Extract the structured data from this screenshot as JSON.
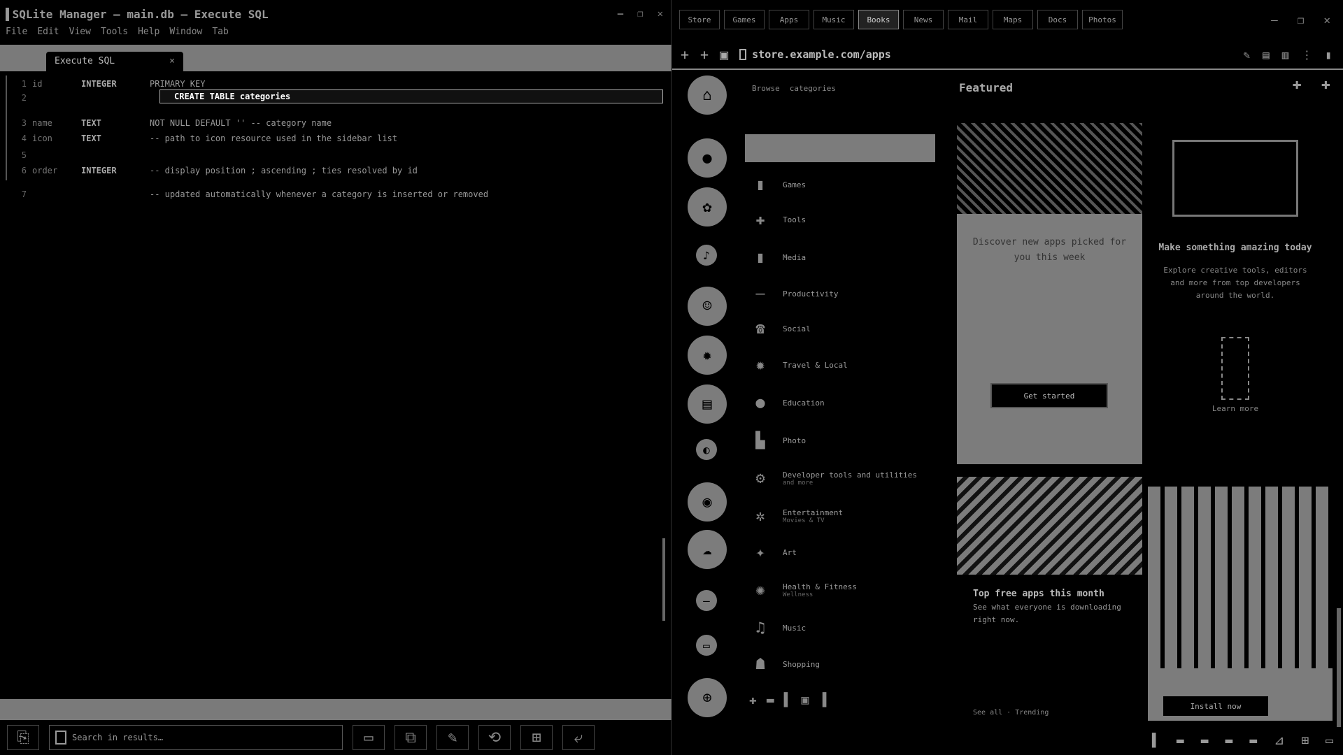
{
  "editor": {
    "title": "▌SQLite Manager — main.db — Execute SQL",
    "title_ctrls": [
      "—",
      "❐",
      "✕"
    ],
    "menu": [
      "File",
      "Edit",
      "View",
      "Tools",
      "Help",
      "Window",
      "Tab"
    ],
    "tab_label": "Execute SQL",
    "tab_close": "×",
    "lines": [
      {
        "ln": "1",
        "fld": "id",
        "nm": "INTEGER",
        "txt": "PRIMARY KEY"
      },
      {
        "ln": "2",
        "fld": "",
        "nm": "",
        "txt": ""
      },
      {
        "ln": "3",
        "fld": "name",
        "nm": "TEXT",
        "txt": "NOT NULL DEFAULT '' -- category name"
      },
      {
        "ln": "4",
        "fld": "icon",
        "nm": "TEXT",
        "txt": "-- path to icon resource used in the sidebar list"
      },
      {
        "ln": "5",
        "fld": "",
        "nm": "",
        "txt": ""
      },
      {
        "ln": "6",
        "fld": "order",
        "nm": "INTEGER",
        "txt": "-- display position ; ascending ; ties resolved by id"
      },
      {
        "ln": "7",
        "fld": "",
        "nm": "",
        "txt": "-- updated automatically whenever a category is inserted or removed"
      }
    ],
    "current_cell": "CREATE TABLE categories",
    "search_placeholder": "Search in results…",
    "bottom_icons": [
      "⎘",
      "▭",
      "⧉",
      "✎",
      "⟲",
      "⊞",
      "⤶"
    ]
  },
  "browser": {
    "tabs": [
      "Store",
      "Games",
      "Apps",
      "Music",
      "Books",
      "News",
      "Mail",
      "Maps",
      "Docs",
      "Photos"
    ],
    "window_ctrls": [
      "—",
      "❐",
      "✕"
    ],
    "nav_buttons": [
      "+",
      "+",
      "▣",
      "▯"
    ],
    "url": "store.example.com/apps",
    "addr_right": [
      "✎",
      "▤",
      "▥",
      "⋮",
      "▮"
    ],
    "rail_icons": [
      "⌂",
      "●",
      "✿",
      "♪",
      "☺",
      "✹",
      "▤",
      "◐",
      "◉",
      "☁",
      "—",
      "▭",
      "⊕"
    ],
    "cats_head": [
      "Browse",
      "categories"
    ],
    "categories": [
      {
        "icon": "▮",
        "label": "Games"
      },
      {
        "icon": "✚",
        "label": "Tools"
      },
      {
        "icon": "▮",
        "label": "Media"
      },
      {
        "icon": "—",
        "label": "Productivity"
      },
      {
        "icon": "☎",
        "label": "Social"
      },
      {
        "icon": "✹",
        "label": "Travel & Local"
      },
      {
        "icon": "●",
        "label": "Education"
      },
      {
        "icon": "▙",
        "label": "Photo"
      },
      {
        "icon": "⚙",
        "label": "Developer tools and utilities",
        "sub": "and more"
      },
      {
        "icon": "✲",
        "label": "Entertainment",
        "sub": "Movies & TV"
      },
      {
        "icon": "✦",
        "label": "Art"
      },
      {
        "icon": "✺",
        "label": "Health & Fitness",
        "sub": "Wellness"
      },
      {
        "icon": "♫",
        "label": "Music"
      },
      {
        "icon": "☗",
        "label": "Shopping"
      }
    ],
    "cats_footer": [
      "✚",
      "▬",
      "▌",
      "▣",
      "▐"
    ],
    "promo_head": "Featured",
    "promo_actions": [
      "✚",
      "✚"
    ],
    "card1_title": "Discover new apps picked for you this week",
    "card1_button": "Get started",
    "side_title": "Make something amazing today",
    "side_desc": "Explore creative tools, editors and more from top developers around the world.",
    "side_caption": "Learn more",
    "card2_head": "Top free apps this month",
    "card2_desc": "See what everyone is downloading right now.",
    "card2_foot": "See all · Trending",
    "card3_button": "Install now",
    "bottom_icons": [
      "▌",
      "▬",
      "▬",
      "▬",
      "▬",
      "⊿",
      "⊞",
      "▭"
    ]
  }
}
